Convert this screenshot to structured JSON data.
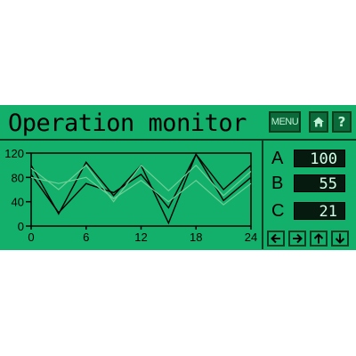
{
  "header": {
    "title": "Operation monitor"
  },
  "buttons": {
    "menu_label": "MENU",
    "home_icon": "home-icon",
    "help_label": "?"
  },
  "meters": [
    {
      "label": "A",
      "value": "100"
    },
    {
      "label": "B",
      "value": "55"
    },
    {
      "label": "C",
      "value": "21"
    }
  ],
  "nav_icons": [
    "arrow-left-icon",
    "arrow-right-icon",
    "arrow-up-icon",
    "arrow-down-icon"
  ],
  "colors": {
    "panel": "#12b06b",
    "button": "#0b6a39",
    "display": "#061a10",
    "series_dark": "#000000",
    "series_light": "#6fcf97"
  },
  "chart_data": {
    "type": "line",
    "x": [
      0,
      3,
      6,
      9,
      12,
      15,
      18,
      21,
      24
    ],
    "xticks": [
      0,
      6,
      12,
      18,
      24
    ],
    "yticks": [
      0,
      40,
      80,
      120
    ],
    "xlim": [
      0,
      24
    ],
    "ylim": [
      0,
      120
    ],
    "grid": false,
    "series": [
      {
        "values": [
          100,
          20,
          105,
          50,
          100,
          5,
          118,
          60,
          100
        ]
      },
      {
        "values": [
          85,
          22,
          70,
          55,
          85,
          30,
          118,
          42,
          80
        ]
      },
      {
        "values": [
          95,
          60,
          100,
          40,
          100,
          58,
          100,
          50,
          90
        ]
      },
      {
        "values": [
          80,
          70,
          80,
          45,
          75,
          40,
          75,
          35,
          70
        ]
      }
    ]
  }
}
